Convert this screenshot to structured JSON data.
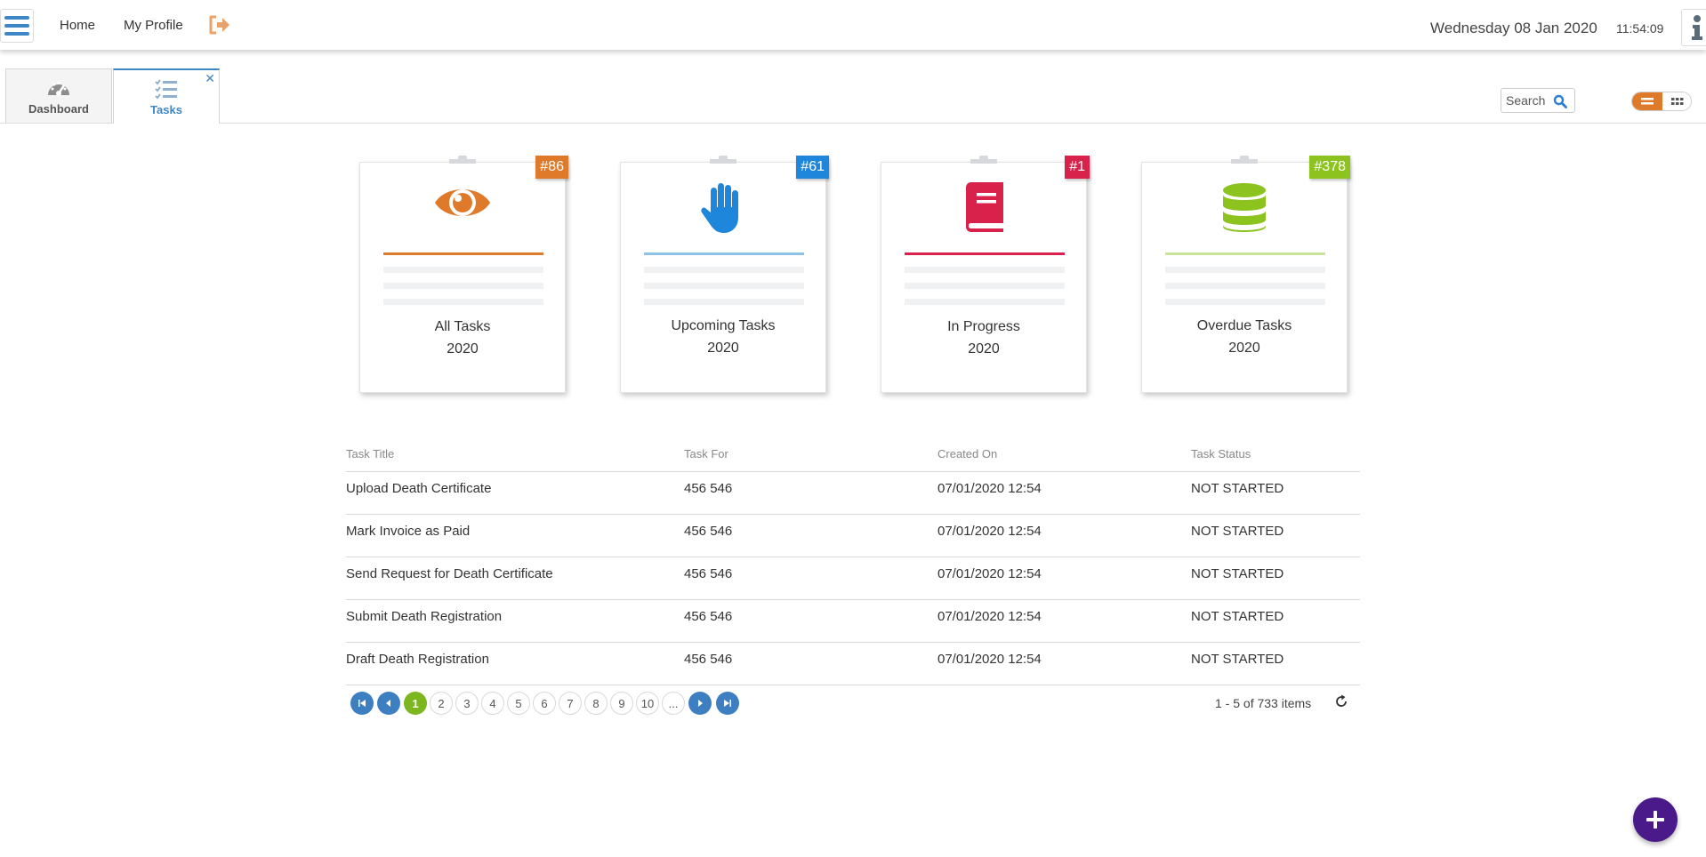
{
  "header": {
    "nav": [
      "Home",
      "My Profile"
    ],
    "date": "Wednesday 08 Jan 2020",
    "time": "11:54:09",
    "icons": {
      "menu": "hamburger-menu-icon",
      "logout": "sign-out-icon",
      "info": "info-icon"
    }
  },
  "tabs": [
    {
      "label": "Dashboard",
      "icon": "speedometer-icon"
    },
    {
      "label": "Tasks",
      "icon": "task-list-icon",
      "closable": true
    }
  ],
  "search": {
    "label": "Search"
  },
  "view_toggle": {
    "active": "list",
    "options": [
      "list-view-icon",
      "grid-view-icon"
    ]
  },
  "cards": [
    {
      "title": "All Tasks",
      "year": "2020",
      "badge": "#86",
      "color": "#e07a2b",
      "icon": "eye-icon"
    },
    {
      "title": "Upcoming Tasks",
      "year": "2020",
      "badge": "#61",
      "color": "#1e86db",
      "icon": "hand-icon"
    },
    {
      "title": "In Progress",
      "year": "2020",
      "badge": "#1",
      "color": "#d8224b",
      "icon": "book-icon"
    },
    {
      "title": "Overdue Tasks",
      "year": "2020",
      "badge": "#378",
      "color": "#8cc31f",
      "icon": "database-icon"
    }
  ],
  "table": {
    "columns": [
      "Task Title",
      "Task For",
      "Created On",
      "Task Status"
    ],
    "rows": [
      [
        "Upload Death Certificate",
        "456 546",
        "07/01/2020 12:54",
        "NOT STARTED"
      ],
      [
        "Mark Invoice as Paid",
        "456 546",
        "07/01/2020 12:54",
        "NOT STARTED"
      ],
      [
        "Send Request for Death Certificate",
        "456 546",
        "07/01/2020 12:54",
        "NOT STARTED"
      ],
      [
        "Submit Death Registration",
        "456 546",
        "07/01/2020 12:54",
        "NOT STARTED"
      ],
      [
        "Draft Death Registration",
        "456 546",
        "07/01/2020 12:54",
        "NOT STARTED"
      ]
    ]
  },
  "pagination": {
    "pages": [
      "1",
      "2",
      "3",
      "4",
      "5",
      "6",
      "7",
      "8",
      "9",
      "10",
      "..."
    ],
    "current": "1",
    "summary": "1 - 5 of 733 items"
  }
}
